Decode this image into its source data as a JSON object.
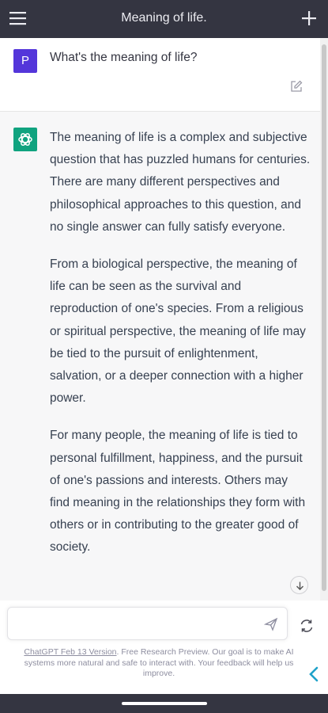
{
  "header": {
    "title": "Meaning of life.",
    "menu_icon": "hamburger-menu-icon",
    "new_chat_icon": "plus-icon"
  },
  "conversation": {
    "user_message": {
      "avatar_letter": "P",
      "avatar_color": "#5436da",
      "text": "What's the meaning of life?",
      "edit_icon": "edit-icon"
    },
    "assistant_message": {
      "avatar_icon": "openai-logo-icon",
      "avatar_color": "#10a37f",
      "paragraphs": [
        "The meaning of life is a complex and subjective question that has puzzled humans for centuries. There are many different perspectives and philosophical approaches to this question, and no single answer can fully satisfy everyone.",
        "From a biological perspective, the meaning of life can be seen as the survival and reproduction of one's species. From a religious or spiritual perspective, the meaning of life may be tied to the pursuit of enlightenment, salvation, or a deeper connection with a higher power.",
        "For many people, the meaning of life is tied to personal fulfillment, happiness, and the pursuit of one's passions and interests. Others may find meaning in the relationships they form with others or in contributing to the greater good of society."
      ]
    }
  },
  "composer": {
    "placeholder": "",
    "send_icon": "send-icon",
    "regenerate_icon": "refresh-icon"
  },
  "footer": {
    "version_link": "ChatGPT Feb 13 Version",
    "note": ". Free Research Preview. Our goal is to make AI systems more natural and safe to interact with. Your feedback will help us improve."
  },
  "colors": {
    "header_bg": "#343541",
    "assistant_bg": "#f7f7f8",
    "accent": "#10a37f"
  }
}
